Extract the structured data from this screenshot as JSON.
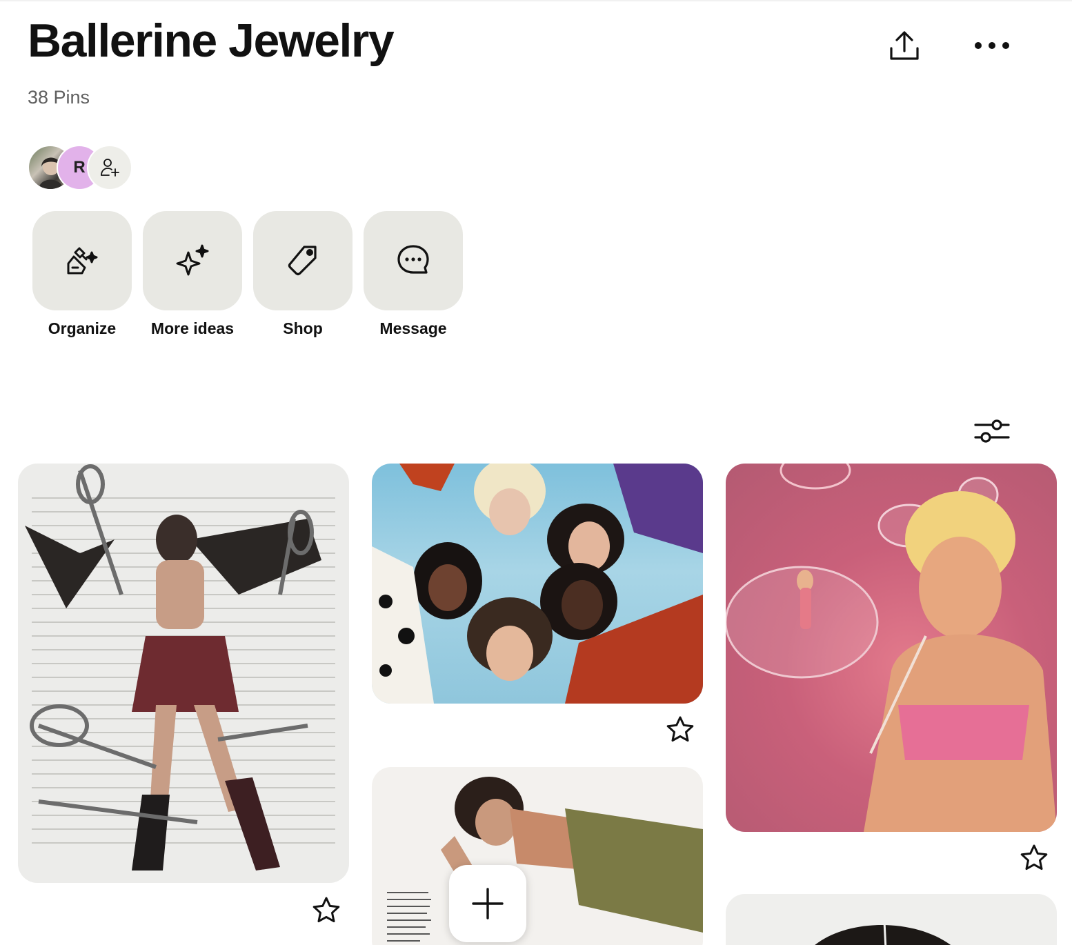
{
  "board": {
    "title": "Ballerine Jewelry",
    "pin_count": "38 Pins"
  },
  "header_icons": {
    "share": "share-icon",
    "more": "more-icon"
  },
  "collaborators": {
    "avatar_photo": "user-avatar",
    "avatar_r_initial": "R",
    "add_collaborator": "add-person-icon"
  },
  "actions": [
    {
      "label": "Organize",
      "icon": "broom-sparkle-icon"
    },
    {
      "label": "More ideas",
      "icon": "sparkle-icon"
    },
    {
      "label": "Shop",
      "icon": "tag-icon"
    },
    {
      "label": "Message",
      "icon": "chat-bubble-icon"
    }
  ],
  "filter": {
    "icon": "sliders-icon"
  },
  "pins": [
    {
      "name": "collage-pin-safety-pins"
    },
    {
      "name": "group-portrait-pin"
    },
    {
      "name": "pink-bubbles-pin"
    },
    {
      "name": "magazine-pin"
    },
    {
      "name": "portrait-pin"
    }
  ],
  "create_button": {
    "icon": "plus-icon"
  },
  "colors": {
    "tile_bg": "#e8e8e3",
    "avatar_r_bg": "#e2b2ea",
    "muted_text": "#5f5f5f"
  }
}
